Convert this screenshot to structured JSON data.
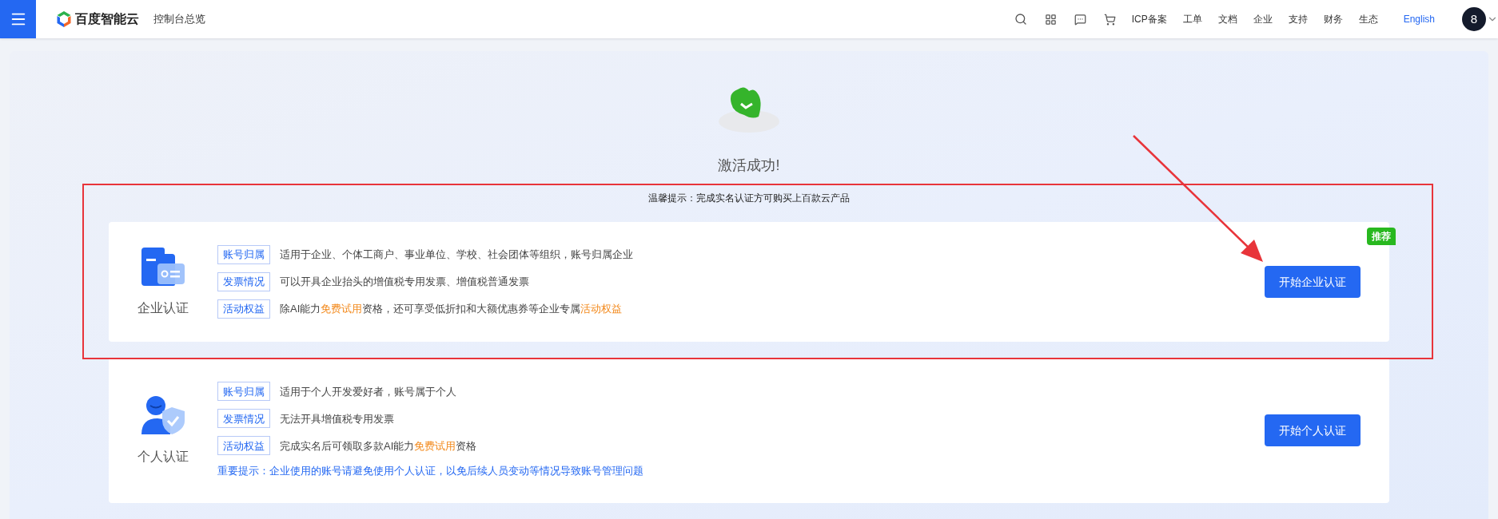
{
  "header": {
    "brand": "百度智能云",
    "page_title": "控制台总览",
    "nav_links": [
      {
        "label": "ICP备案"
      },
      {
        "label": "工单"
      },
      {
        "label": "文档"
      },
      {
        "label": "企业"
      },
      {
        "label": "支持"
      },
      {
        "label": "财务"
      },
      {
        "label": "生态"
      }
    ],
    "language": "English",
    "avatar": "8"
  },
  "success": {
    "title": "激活成功!",
    "tip": "温馨提示：完成实名认证方可购买上百款云产品"
  },
  "cards": [
    {
      "kind": "enterprise",
      "title": "企业认证",
      "badge": "推荐",
      "button": "开始企业认证",
      "rows": [
        {
          "tag": "账号归属",
          "segments": [
            {
              "text": "适用于企业、个体工商户、事业单位、学校、社会团体等组织，账号归属企业",
              "highlight": false
            }
          ]
        },
        {
          "tag": "发票情况",
          "segments": [
            {
              "text": "可以开具企业抬头的增值税专用发票、增值税普通发票",
              "highlight": false
            }
          ]
        },
        {
          "tag": "活动权益",
          "segments": [
            {
              "text": "除AI能力",
              "highlight": false
            },
            {
              "text": "免费试用",
              "highlight": true
            },
            {
              "text": "资格，还可享受低折扣和大额优惠券等企业专属",
              "highlight": false
            },
            {
              "text": "活动权益",
              "highlight": true
            }
          ]
        }
      ]
    },
    {
      "kind": "personal",
      "title": "个人认证",
      "button": "开始个人认证",
      "note": "重要提示：企业使用的账号请避免使用个人认证，以免后续人员变动等情况导致账号管理问题",
      "rows": [
        {
          "tag": "账号归属",
          "segments": [
            {
              "text": "适用于个人开发爱好者，账号属于个人",
              "highlight": false
            }
          ]
        },
        {
          "tag": "发票情况",
          "segments": [
            {
              "text": "无法开具增值税专用发票",
              "highlight": false
            }
          ]
        },
        {
          "tag": "活动权益",
          "segments": [
            {
              "text": "完成实名后可领取多款AI能力",
              "highlight": false
            },
            {
              "text": "免费试用",
              "highlight": true
            },
            {
              "text": "资格",
              "highlight": false
            }
          ]
        }
      ]
    }
  ],
  "annotation": {
    "box": true,
    "arrow": true
  }
}
